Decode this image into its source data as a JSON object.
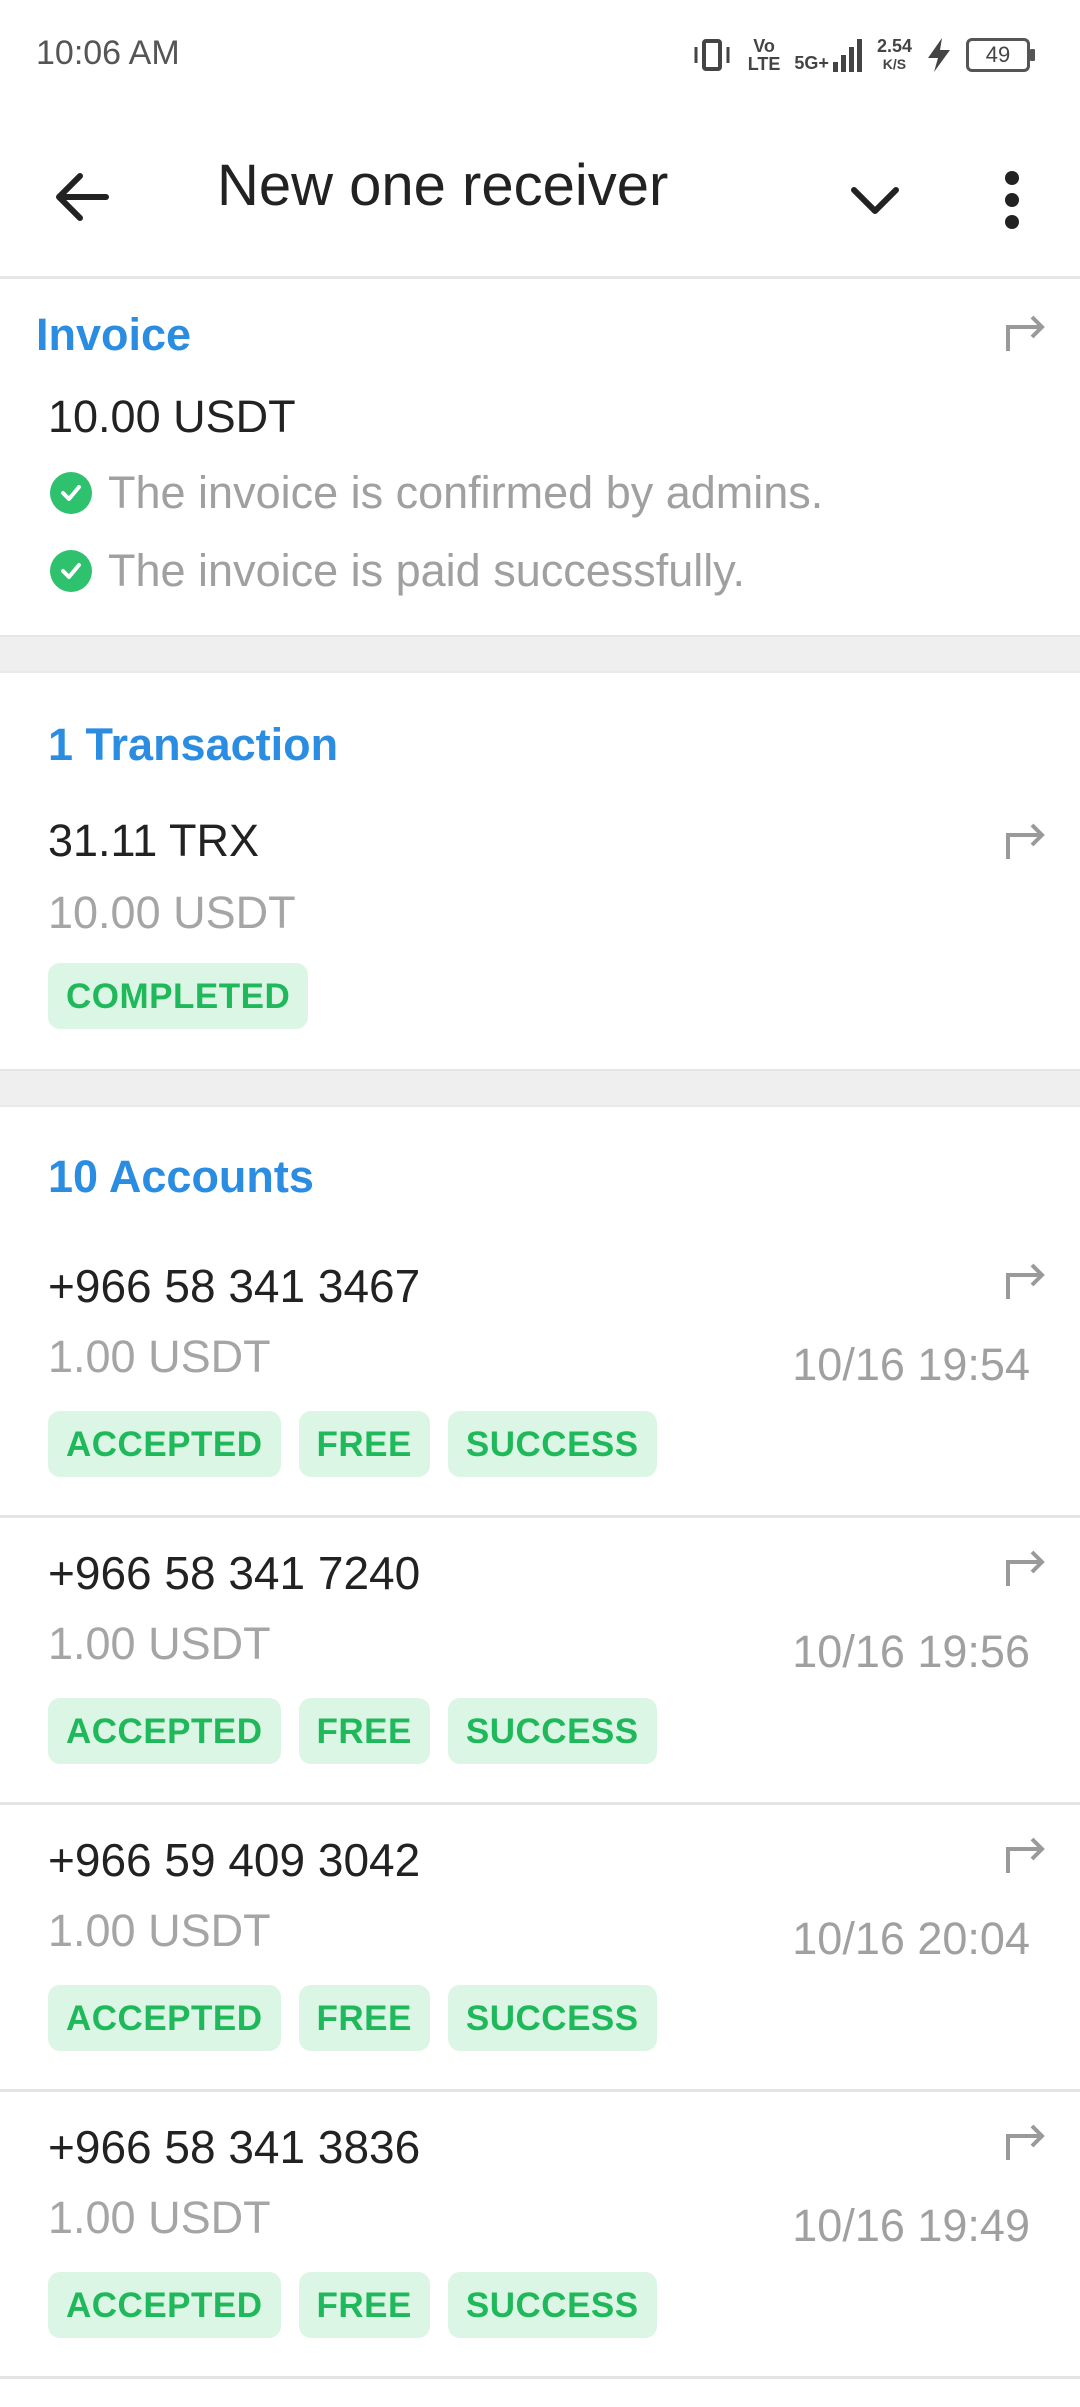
{
  "status_bar": {
    "time": "10:06 AM",
    "volte_top": "Vo",
    "volte_bottom": "LTE",
    "network": "5G+",
    "speed_top": "2.54",
    "speed_bottom": "K/S",
    "battery": "49"
  },
  "app_bar": {
    "title": "New one receiver"
  },
  "invoice": {
    "title": "Invoice",
    "amount": "10.00 USDT",
    "status_lines": [
      "The invoice is confirmed by admins.",
      "The invoice is paid successfully."
    ]
  },
  "transactions": {
    "title": "1 Transaction",
    "items": [
      {
        "amount": "31.11 TRX",
        "sub_amount": "10.00 USDT",
        "badge": "COMPLETED"
      }
    ]
  },
  "accounts": {
    "title": "10 Accounts",
    "items": [
      {
        "phone": "+966 58 341 3467",
        "amount": "1.00 USDT",
        "time": "10/16 19:54",
        "badges": [
          "ACCEPTED",
          "FREE",
          "SUCCESS"
        ]
      },
      {
        "phone": "+966 58 341 7240",
        "amount": "1.00 USDT",
        "time": "10/16 19:56",
        "badges": [
          "ACCEPTED",
          "FREE",
          "SUCCESS"
        ]
      },
      {
        "phone": "+966 59 409 3042",
        "amount": "1.00 USDT",
        "time": "10/16 20:04",
        "badges": [
          "ACCEPTED",
          "FREE",
          "SUCCESS"
        ]
      },
      {
        "phone": "+966 58 341 3836",
        "amount": "1.00 USDT",
        "time": "10/16 19:49",
        "badges": [
          "ACCEPTED",
          "FREE",
          "SUCCESS"
        ]
      }
    ]
  },
  "colors": {
    "accent": "#2a8de2",
    "success": "#1fb85a",
    "success_bg": "#dbf6e4",
    "check": "#2ec26e"
  },
  "icons": {
    "back": "arrow-left-icon",
    "expand": "chevron-down-icon",
    "more": "more-vert-icon",
    "share": "share-arrow-icon",
    "check": "check-circle-icon"
  }
}
